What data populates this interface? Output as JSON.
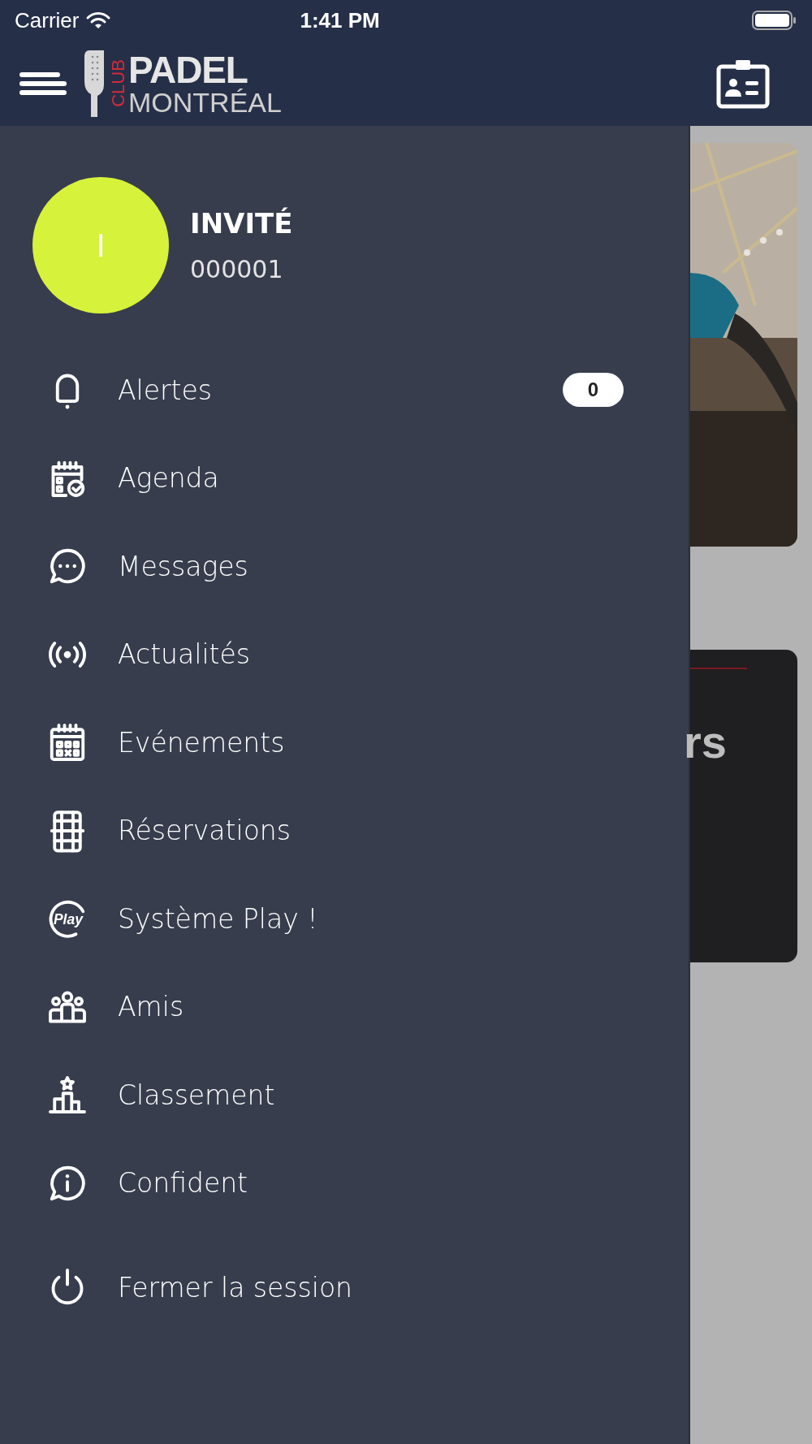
{
  "status_bar": {
    "carrier": "Carrier",
    "time": "1:41 PM"
  },
  "header": {
    "logo": {
      "club": "CLUB",
      "padel": "PADEL",
      "montreal": "MONTRÉAL"
    }
  },
  "profile": {
    "initial": "I",
    "name": "INVITÉ",
    "number": "000001"
  },
  "menu": [
    {
      "label": "Alertes",
      "badge": "0"
    },
    {
      "label": "Agenda"
    },
    {
      "label": "Messages"
    },
    {
      "label": "Actualités"
    },
    {
      "label": "Evénements"
    },
    {
      "label": "Réservations"
    },
    {
      "label": "Système Play !",
      "icon_text": "Play"
    },
    {
      "label": "Amis"
    },
    {
      "label": "Classement"
    },
    {
      "label": "Confident"
    },
    {
      "label": "Fermer la session"
    }
  ],
  "background": {
    "card_text": "rs"
  }
}
